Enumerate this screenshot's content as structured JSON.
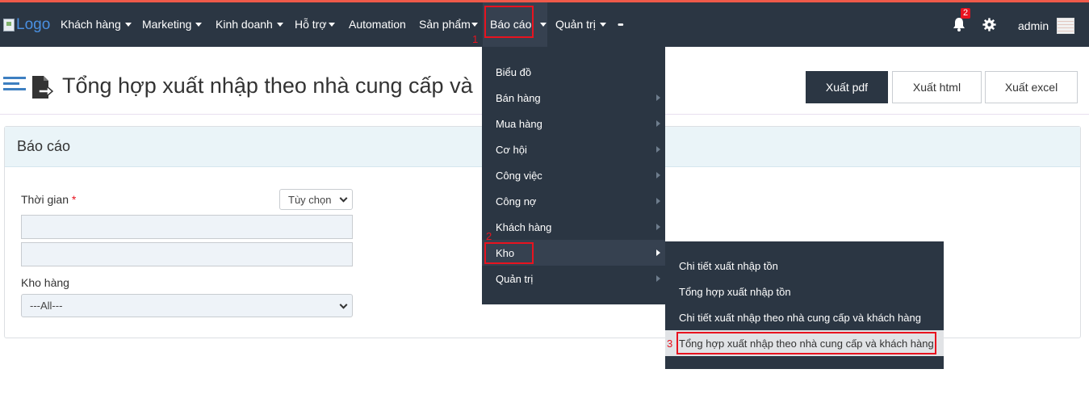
{
  "header": {
    "logo_alt": "Logo",
    "nav": [
      {
        "label": "Khách hàng",
        "caret": true
      },
      {
        "label": "Marketing",
        "caret": true
      },
      {
        "label": "Kinh doanh",
        "caret": true
      },
      {
        "label": "Hỗ trợ",
        "caret": true
      },
      {
        "label": "Automation",
        "caret": false
      },
      {
        "label": "Sản phẩm",
        "caret": true
      },
      {
        "label": "Báo cáo",
        "caret": true
      },
      {
        "label": "Quản trị",
        "caret": true
      },
      {
        "label": "•••",
        "caret": false
      }
    ],
    "notification_count": "2",
    "user": "admin"
  },
  "markers": [
    "1",
    "2",
    "3"
  ],
  "page": {
    "title": "Tổng hợp xuất nhập theo nhà cung cấp và",
    "buttons": {
      "pdf": "Xuất pdf",
      "html": "Xuất html",
      "excel": "Xuất excel"
    }
  },
  "panel": {
    "title": "Báo cáo",
    "time_label": "Thời gian",
    "required_mark": "*",
    "time_option": "Tùy chọn",
    "warehouse_label": "Kho hàng",
    "warehouse_value": "---All---"
  },
  "dropdown": {
    "items": [
      "Biểu đồ",
      "Bán hàng",
      "Mua hàng",
      "Cơ hội",
      "Công việc",
      "Công nợ",
      "Khách hàng",
      "Kho",
      "Quản trị"
    ]
  },
  "submenu": {
    "items": [
      "Chi tiết xuất nhập tồn",
      "Tổng hợp xuất nhập tồn",
      "Chi tiết xuất nhập theo nhà cung cấp và khách hàng",
      "Tổng hợp xuất nhập theo nhà cung cấp và khách hàng"
    ]
  },
  "colors": {
    "nav_bg": "#2b3643",
    "accent_top": "#ef5a4a",
    "marker": "#e8131f",
    "panel_head": "#eaf4f8"
  },
  "icons": [
    "menu-lines-icon",
    "export-file-icon",
    "bell-icon",
    "gear-icon",
    "caret-down-icon",
    "chevron-right-icon"
  ]
}
